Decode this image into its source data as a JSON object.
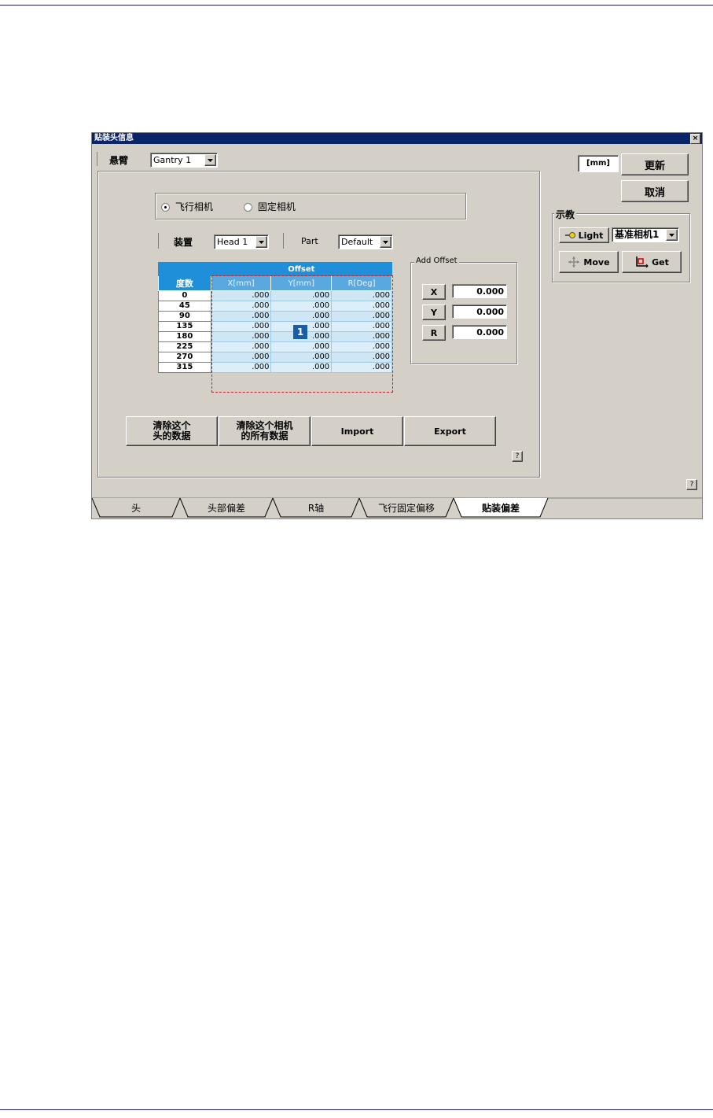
{
  "window": {
    "title": "贴装头信息",
    "close": "×"
  },
  "gantry": {
    "label": "悬臂",
    "value": "Gantry 1"
  },
  "unit_label": "[mm]",
  "buttons": {
    "update": "更新",
    "cancel": "取消",
    "clear_head": "清除这个\n头的数据",
    "clear_camera": "清除这个相机\n的所有数据",
    "import": "Import",
    "export": "Export",
    "help": "?"
  },
  "camera_mode": {
    "option1": "飞行相机",
    "option2": "固定相机",
    "selected": "飞行相机"
  },
  "device": {
    "label": "装置",
    "value": "Head 1"
  },
  "part": {
    "label": "Part",
    "value": "Default"
  },
  "table": {
    "group_header": "Offset",
    "columns": [
      "度数",
      "X[mm]",
      "Y[mm]",
      "R[Deg]"
    ],
    "rows": [
      [
        "0",
        ".000",
        ".000",
        ".000"
      ],
      [
        "45",
        ".000",
        ".000",
        ".000"
      ],
      [
        "90",
        ".000",
        ".000",
        ".000"
      ],
      [
        "135",
        ".000",
        ".000",
        ".000"
      ],
      [
        "180",
        ".000",
        ".000",
        ".000"
      ],
      [
        "225",
        ".000",
        ".000",
        ".000"
      ],
      [
        "270",
        ".000",
        ".000",
        ".000"
      ],
      [
        "315",
        ".000",
        ".000",
        ".000"
      ]
    ],
    "callout": "1"
  },
  "add_offset": {
    "title": "Add Offset",
    "fields": [
      {
        "label": "X",
        "value": "0.000"
      },
      {
        "label": "Y",
        "value": "0.000"
      },
      {
        "label": "R",
        "value": "0.000"
      }
    ]
  },
  "teach": {
    "title": "示教",
    "light_label": "Light",
    "camera_value": "基准相机1",
    "move_label": "Move",
    "get_label": "Get"
  },
  "tabs": [
    "头",
    "头部偏差",
    "R轴",
    "飞行固定偏移",
    "贴装偏差"
  ],
  "active_tab": "贴装偏差",
  "colors": {
    "titlebar": "#0a246a",
    "table_header": "#1e8fd8",
    "table_cell": "#cfe6f5",
    "callout": "#1a5ea8"
  }
}
